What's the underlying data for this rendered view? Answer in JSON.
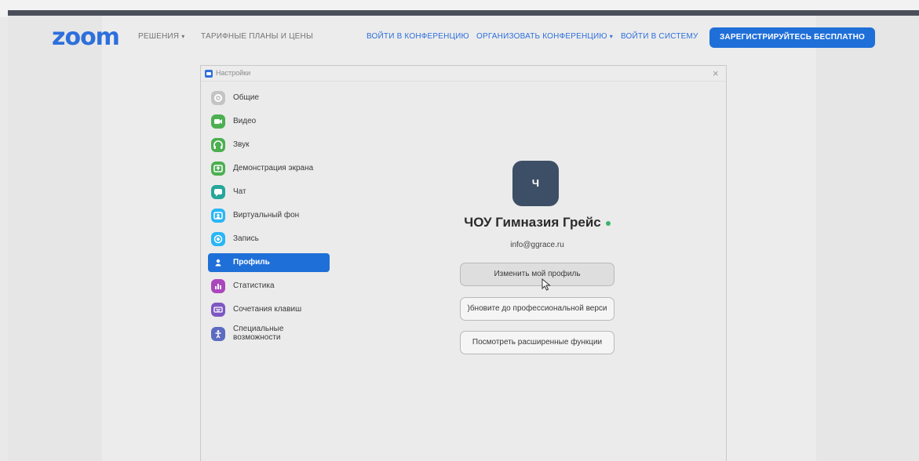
{
  "nav": {
    "logo": "zoom",
    "solutions": "РЕШЕНИЯ",
    "plans": "ТАРИФНЫЕ ПЛАНЫ И ЦЕНЫ",
    "join": "ВОЙТИ В КОНФЕРЕНЦИЮ",
    "host": "ОРГАНИЗОВАТЬ КОНФЕРЕНЦИЮ",
    "signin": "ВОЙТИ В СИСТЕМУ",
    "signup": "ЗАРЕГИСТРИРУЙТЕСЬ БЕСПЛАТНО"
  },
  "window": {
    "title": "Настройки",
    "close_glyph": "×"
  },
  "sidebar": {
    "items": [
      {
        "label": "Общие",
        "icon": "gear-icon",
        "color": "#bdbdbd"
      },
      {
        "label": "Видео",
        "icon": "video-icon",
        "color": "#4caf50"
      },
      {
        "label": "Звук",
        "icon": "headphones-icon",
        "color": "#4caf50"
      },
      {
        "label": "Демонстрация экрана",
        "icon": "share-screen-icon",
        "color": "#4caf50"
      },
      {
        "label": "Чат",
        "icon": "chat-icon",
        "color": "#26a69a"
      },
      {
        "label": "Виртуальный фон",
        "icon": "virtual-background-icon",
        "color": "#29b6f6"
      },
      {
        "label": "Запись",
        "icon": "record-icon",
        "color": "#29b6f6"
      },
      {
        "label": "Профиль",
        "icon": "user-icon",
        "color": "#1f6fd8"
      },
      {
        "label": "Статистика",
        "icon": "statistics-icon",
        "color": "#ab47bc"
      },
      {
        "label": "Сочетания клавиш",
        "icon": "keyboard-icon",
        "color": "#7e57c2"
      },
      {
        "label": "Специальные возможности",
        "icon": "accessibility-icon",
        "color": "#5c6bc0"
      }
    ],
    "active_index": 7
  },
  "profile": {
    "avatar_letter": "Ч",
    "name": "ЧОУ Гимназия Грейс",
    "email": "info@ggrace.ru",
    "buttons": {
      "edit": "Изменить мой профиль",
      "upgrade": ")бновите до профессиональной верси",
      "features": "Посмотреть расширенные функции"
    }
  },
  "colors": {
    "brand": "#2d6fdc",
    "signup": "#1f6fd8",
    "presence": "#3bb46a",
    "avatar": "#3d4f66"
  }
}
